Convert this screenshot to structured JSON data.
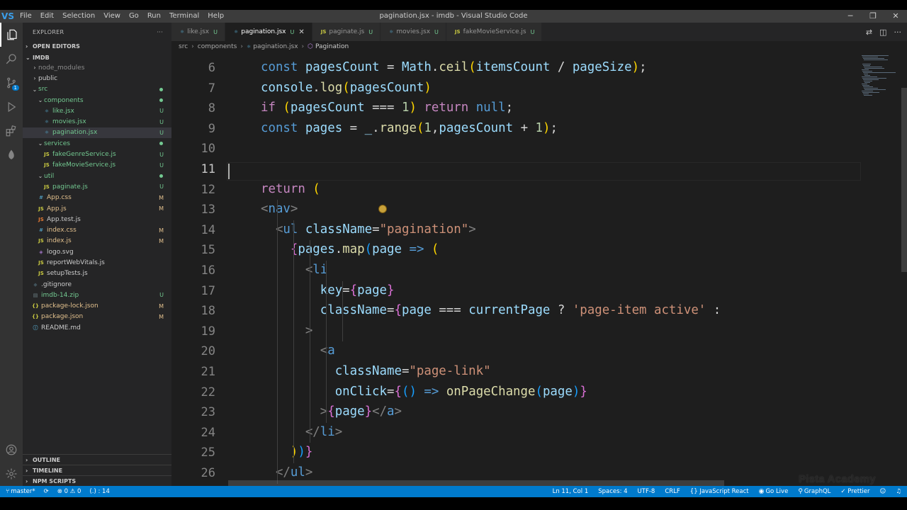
{
  "window": {
    "title": "pagination.jsx - imdb - Visual Studio Code",
    "logo": "VS",
    "menu": [
      "File",
      "Edit",
      "Selection",
      "View",
      "Go",
      "Run",
      "Terminal",
      "Help"
    ],
    "controls": {
      "minimize": "─",
      "restore": "❐",
      "close": "✕"
    }
  },
  "activity_bar": {
    "items": [
      "explorer-icon",
      "search-icon",
      "source-control-icon",
      "run-debug-icon",
      "extensions-icon",
      "mongodb-leaf-icon"
    ],
    "bottom": [
      "account-icon",
      "manage-gear-icon"
    ],
    "source_control_badge": "1"
  },
  "sidebar": {
    "header": "EXPLORER",
    "more": "···",
    "open_editors": "OPEN EDITORS",
    "project": "IMDB",
    "tree": [
      {
        "label": "node_modules",
        "depth": 1,
        "type": "folder",
        "chev": "›",
        "dim": true
      },
      {
        "label": "public",
        "depth": 1,
        "type": "folder",
        "chev": "›"
      },
      {
        "label": "src",
        "depth": 1,
        "type": "folder",
        "chev": "⌄",
        "dot": true
      },
      {
        "label": "components",
        "depth": 2,
        "type": "folder",
        "chev": "⌄",
        "dot": true
      },
      {
        "label": "like.jsx",
        "depth": 3,
        "type": "react",
        "badge": "U"
      },
      {
        "label": "movies.jsx",
        "depth": 3,
        "type": "react",
        "badge": "U"
      },
      {
        "label": "pagination.jsx",
        "depth": 3,
        "type": "react",
        "badge": "U",
        "selected": true
      },
      {
        "label": "services",
        "depth": 2,
        "type": "folder",
        "chev": "⌄",
        "dot": true
      },
      {
        "label": "fakeGenreService.js",
        "depth": 3,
        "type": "js",
        "badge": "U"
      },
      {
        "label": "fakeMovieService.js",
        "depth": 3,
        "type": "js",
        "badge": "U"
      },
      {
        "label": "util",
        "depth": 2,
        "type": "folder",
        "chev": "⌄",
        "dot": true
      },
      {
        "label": "paginate.js",
        "depth": 3,
        "type": "js",
        "badge": "U"
      },
      {
        "label": "App.css",
        "depth": 2,
        "type": "css",
        "badge": "M"
      },
      {
        "label": "App.js",
        "depth": 2,
        "type": "js",
        "badge": "M"
      },
      {
        "label": "App.test.js",
        "depth": 2,
        "type": "test"
      },
      {
        "label": "index.css",
        "depth": 2,
        "type": "css",
        "badge": "M"
      },
      {
        "label": "index.js",
        "depth": 2,
        "type": "js",
        "badge": "M"
      },
      {
        "label": "logo.svg",
        "depth": 2,
        "type": "svg"
      },
      {
        "label": "reportWebVitals.js",
        "depth": 2,
        "type": "js"
      },
      {
        "label": "setupTests.js",
        "depth": 2,
        "type": "js"
      },
      {
        "label": ".gitignore",
        "depth": 1,
        "type": "git"
      },
      {
        "label": "imdb-14.zip",
        "depth": 1,
        "type": "zip",
        "badge": "U"
      },
      {
        "label": "package-lock.json",
        "depth": 1,
        "type": "json",
        "badge": "M"
      },
      {
        "label": "package.json",
        "depth": 1,
        "type": "json",
        "badge": "M"
      },
      {
        "label": "README.md",
        "depth": 1,
        "type": "md"
      }
    ],
    "bottom_sections": [
      "OUTLINE",
      "TIMELINE",
      "NPM SCRIPTS"
    ]
  },
  "tabs": [
    {
      "label": "like.jsx",
      "icon": "react",
      "status": "U"
    },
    {
      "label": "pagination.jsx",
      "icon": "react",
      "status": "U",
      "active": true,
      "close": "✕"
    },
    {
      "label": "paginate.js",
      "icon": "js",
      "status": "U"
    },
    {
      "label": "movies.jsx",
      "icon": "react",
      "status": "U"
    },
    {
      "label": "fakeMovieService.js",
      "icon": "js",
      "status": "U"
    }
  ],
  "breadcrumb": {
    "parts": [
      "src",
      "components",
      "pagination.jsx"
    ],
    "symbol": "Pagination"
  },
  "editor": {
    "lines": [
      {
        "n": "6",
        "code": [
          [
            "  const ",
            "kw"
          ],
          [
            "pagesCount",
            "var"
          ],
          [
            " = ",
            ""
          ],
          [
            "Math",
            "var"
          ],
          [
            ".",
            ""
          ],
          [
            "ceil",
            "fn"
          ],
          [
            "(",
            "br1"
          ],
          [
            "itemsCount",
            "var"
          ],
          [
            " / ",
            ""
          ],
          [
            "pageSize",
            "var"
          ],
          [
            ")",
            "br1"
          ],
          [
            ";",
            ""
          ]
        ]
      },
      {
        "n": "7",
        "code": [
          [
            "  console",
            "var"
          ],
          [
            ".",
            ""
          ],
          [
            "log",
            "fn"
          ],
          [
            "(",
            "br1"
          ],
          [
            "pagesCount",
            "var"
          ],
          [
            ")",
            "br1"
          ]
        ]
      },
      {
        "n": "8",
        "code": [
          [
            "  if ",
            "ctl"
          ],
          [
            "(",
            "br1"
          ],
          [
            "pagesCount",
            "var"
          ],
          [
            " === ",
            ""
          ],
          [
            "1",
            "num"
          ],
          [
            ")",
            "br1"
          ],
          [
            " return ",
            "ctl"
          ],
          [
            "null",
            "kw"
          ],
          [
            ";",
            ""
          ]
        ]
      },
      {
        "n": "9",
        "code": [
          [
            "  const ",
            "kw"
          ],
          [
            "pages",
            "var"
          ],
          [
            " = ",
            ""
          ],
          [
            "_",
            "var"
          ],
          [
            ".",
            ""
          ],
          [
            "range",
            "fn"
          ],
          [
            "(",
            "br1"
          ],
          [
            "1",
            "num"
          ],
          [
            ",",
            ""
          ],
          [
            "pagesCount",
            "var"
          ],
          [
            " + ",
            ""
          ],
          [
            "1",
            "num"
          ],
          [
            ")",
            "br1"
          ],
          [
            ";",
            ""
          ]
        ]
      },
      {
        "n": "10",
        "code": []
      },
      {
        "n": "11",
        "code": [],
        "current": true
      },
      {
        "n": "12",
        "code": [
          [
            "  return ",
            "ctl"
          ],
          [
            "(",
            "br1"
          ]
        ]
      },
      {
        "n": "13",
        "code": [
          [
            "    <",
            "punc"
          ],
          [
            "nav",
            "tag"
          ],
          [
            ">",
            "punc"
          ]
        ]
      },
      {
        "n": "14",
        "code": [
          [
            "      <",
            "punc"
          ],
          [
            "ul ",
            "tag"
          ],
          [
            "className",
            "var"
          ],
          [
            "=",
            ""
          ],
          [
            "\"pagination\"",
            "str"
          ],
          [
            ">",
            "punc"
          ]
        ]
      },
      {
        "n": "15",
        "code": [
          [
            "        {",
            "br2"
          ],
          [
            "pages",
            "var"
          ],
          [
            ".",
            ""
          ],
          [
            "map",
            "fn"
          ],
          [
            "(",
            "br3"
          ],
          [
            "page",
            "var"
          ],
          [
            " => ",
            "kw"
          ],
          [
            "(",
            "br1"
          ]
        ]
      },
      {
        "n": "16",
        "code": [
          [
            "          <",
            "punc"
          ],
          [
            "li",
            "tag"
          ]
        ]
      },
      {
        "n": "17",
        "code": [
          [
            "            key",
            "var"
          ],
          [
            "=",
            ""
          ],
          [
            "{",
            "br2"
          ],
          [
            "page",
            "var"
          ],
          [
            "}",
            "br2"
          ]
        ]
      },
      {
        "n": "18",
        "code": [
          [
            "            className",
            "var"
          ],
          [
            "=",
            ""
          ],
          [
            "{",
            "br2"
          ],
          [
            "page",
            "var"
          ],
          [
            " === ",
            ""
          ],
          [
            "currentPage",
            "var"
          ],
          [
            " ? ",
            ""
          ],
          [
            "'page-item active'",
            "str"
          ],
          [
            " :",
            ""
          ]
        ]
      },
      {
        "n": "19",
        "code": [
          [
            "          >",
            "punc"
          ]
        ]
      },
      {
        "n": "20",
        "code": [
          [
            "            <",
            "punc"
          ],
          [
            "a",
            "tag"
          ]
        ]
      },
      {
        "n": "21",
        "code": [
          [
            "              className",
            "var"
          ],
          [
            "=",
            ""
          ],
          [
            "\"page-link\"",
            "str"
          ]
        ]
      },
      {
        "n": "22",
        "code": [
          [
            "              onClick",
            "var"
          ],
          [
            "=",
            ""
          ],
          [
            "{",
            "br2"
          ],
          [
            "(",
            "br3"
          ],
          [
            ")",
            "br3"
          ],
          [
            " => ",
            "kw"
          ],
          [
            "onPageChange",
            "fn"
          ],
          [
            "(",
            "br3"
          ],
          [
            "page",
            "var"
          ],
          [
            ")",
            "br3"
          ],
          [
            "}",
            "br2"
          ]
        ]
      },
      {
        "n": "23",
        "code": [
          [
            "            >",
            "punc"
          ],
          [
            "{",
            "br2"
          ],
          [
            "page",
            "var"
          ],
          [
            "}",
            "br2"
          ],
          [
            "</",
            "punc"
          ],
          [
            "a",
            "tag"
          ],
          [
            ">",
            "punc"
          ]
        ]
      },
      {
        "n": "24",
        "code": [
          [
            "          </",
            "punc"
          ],
          [
            "li",
            "tag"
          ],
          [
            ">",
            "punc"
          ]
        ]
      },
      {
        "n": "25",
        "code": [
          [
            "        ",
            ""
          ],
          [
            ")",
            "br1"
          ],
          [
            ")",
            "br3"
          ],
          [
            "}",
            "br2"
          ]
        ]
      },
      {
        "n": "26",
        "code": [
          [
            "      </",
            "punc"
          ],
          [
            "ul",
            "tag"
          ],
          [
            ">",
            "punc"
          ]
        ]
      }
    ]
  },
  "watermark": "Pista Academy",
  "statusbar": {
    "branch": "master*",
    "sync": "⟳",
    "problems": "⊗ 0 ⚠ 0",
    "selection": "(.) : 14",
    "position": "Ln 11, Col 1",
    "spaces": "Spaces: 4",
    "encoding": "UTF-8",
    "eol": "CRLF",
    "language": "{} JavaScript React",
    "golive": "Go Live",
    "graphql": "GraphQL",
    "prettier": "✓ Prettier",
    "feedback": "☺",
    "bell": "♫"
  },
  "colors": {
    "statusbar": "#007acc",
    "editor_bg": "#1e1e1e",
    "sidebar_bg": "#252526",
    "activitybar_bg": "#333333"
  }
}
